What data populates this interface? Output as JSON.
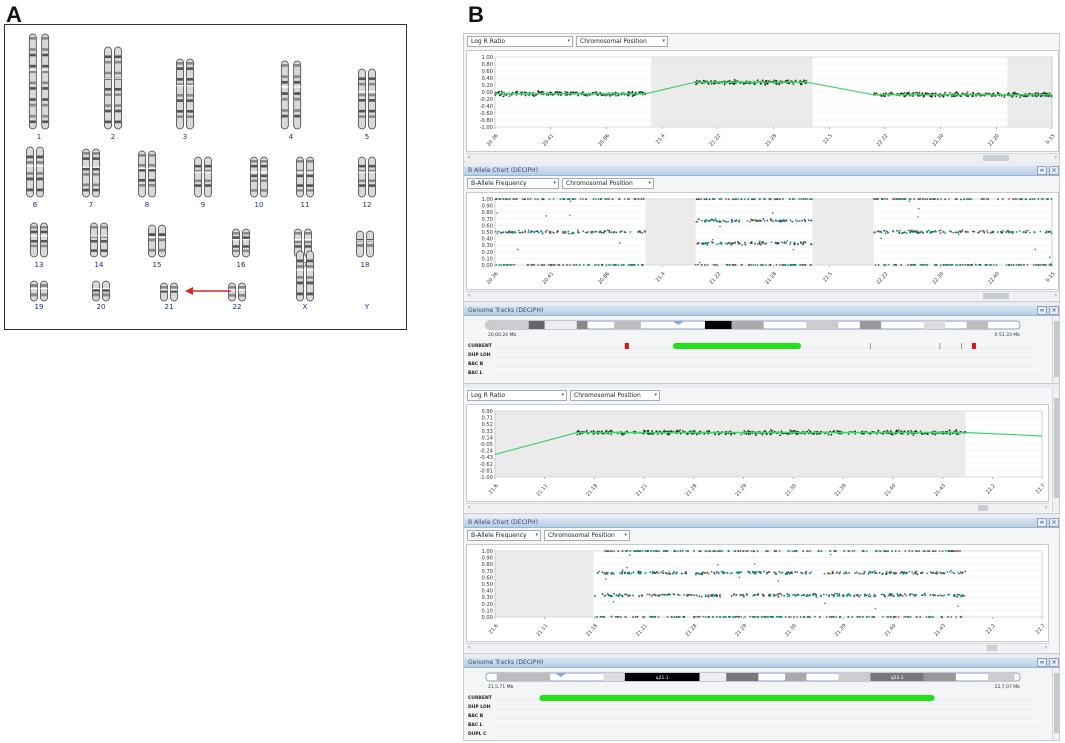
{
  "figure": {
    "panel_a_letter": "A",
    "panel_b_letter": "B"
  },
  "karyotype": {
    "rows": [
      [
        "1",
        "2",
        "3",
        "4",
        "5"
      ],
      [
        "6",
        "7",
        "8",
        "9",
        "10",
        "11",
        "12"
      ],
      [
        "13",
        "14",
        "15",
        "16",
        "17",
        "18"
      ],
      [
        "19",
        "20",
        "21",
        "22",
        "X",
        "Y"
      ]
    ],
    "arrow_target": "21"
  },
  "viewer": {
    "panes": {
      "lrr1": {
        "dropdown1": "Log R Ratio",
        "dropdown2": "Chromosomal Position",
        "yticks": [
          "1.00",
          "0.80",
          "0.60",
          "0.40",
          "0.20",
          "0.00",
          "-0.20",
          "-0.40",
          "-0.60",
          "-0.80",
          "-1.00"
        ],
        "xticks": [
          "20.36",
          "20.41",
          "20.86",
          "21.4",
          "21.22",
          "21.28",
          "22.5",
          "22.22",
          "22.30",
          "22.20",
          "b.15"
        ]
      },
      "baf1": {
        "title": "B Allele Chart (DECIPH)",
        "dropdown1": "B-Allele Frequency",
        "dropdown2": "Chromosomal Position",
        "yticks": [
          "1.00",
          "0.90",
          "0.80",
          "0.70",
          "0.60",
          "0.50",
          "0.40",
          "0.30",
          "0.20",
          "0.10",
          "0.00"
        ],
        "xticks": [
          "20.36",
          "20.41",
          "20.86",
          "21.4",
          "21.22",
          "21.28",
          "22.5",
          "22.22",
          "22.30",
          "22.40",
          "b.15"
        ]
      },
      "genome1": {
        "title": "Genome Tracks (DECIPH)",
        "left_coord": "20,00,24 Mb",
        "right_coord": "X 51,33 Mb",
        "rows": [
          "CURRENT",
          "DUP LOH",
          "BAC B",
          "BAC L"
        ]
      },
      "lrr2": {
        "dropdown1": "Log R Ratio",
        "dropdown2": "Chromosomal Position",
        "yticks": [
          "0.90",
          "0.71",
          "0.52",
          "0.33",
          "0.14",
          "-0.05",
          "-0.24",
          "-0.43",
          "-0.62",
          "-0.81",
          "-1.00"
        ],
        "xticks": [
          "21.6",
          "21.11",
          "21.18",
          "21.21",
          "21.28",
          "21.29",
          "21.30",
          "21.39",
          "21.40",
          "21.43",
          "22.2",
          "22.7"
        ]
      },
      "baf2": {
        "title": "B Allele Chart (DECIPH)",
        "dropdown1": "B-Allele Frequency",
        "dropdown2": "Chromosomal Position",
        "yticks": [
          "1.00",
          "0.90",
          "0.80",
          "0.70",
          "0.60",
          "0.50",
          "0.40",
          "0.30",
          "0.20",
          "0.10",
          "0.00"
        ],
        "xticks": [
          "21.6",
          "21.11",
          "21.18",
          "21.21",
          "21.28",
          "21.29",
          "21.30",
          "21.39",
          "21.40",
          "21.43",
          "22.2",
          "22.7"
        ]
      },
      "genome2": {
        "title": "Genome Tracks (DECIPH)",
        "left_coord": "21,5,71 Mb",
        "right_coord": "22,7,07 Mb",
        "band_left": "q21.1",
        "band_right": "q22.3",
        "rows": [
          "CURRENT",
          "DUP LOH",
          "BAC B",
          "BAC L",
          "DUPL C"
        ]
      }
    }
  },
  "chart_data": [
    {
      "type": "scatter",
      "ylabel": "Log R Ratio",
      "xlabel": "Chromosomal Position",
      "ylim": [
        -1.0,
        1.0
      ],
      "series": [
        {
          "segments": [
            {
              "x_range": [
                0.0,
                0.27
              ],
              "y": -0.05
            },
            {
              "x_range": [
                0.36,
                0.56
              ],
              "y": 0.28
            },
            {
              "x_range": [
                0.68,
                1.0
              ],
              "y": -0.08
            }
          ]
        }
      ]
    },
    {
      "type": "scatter",
      "ylabel": "B-Allele Frequency",
      "xlabel": "Chromosomal Position",
      "ylim": [
        0.0,
        1.0
      ],
      "bands": [
        {
          "x_range": [
            0.0,
            0.27
          ],
          "levels": [
            0.0,
            0.5,
            1.0
          ]
        },
        {
          "x_range": [
            0.36,
            0.57
          ],
          "levels": [
            0.0,
            0.33,
            0.67,
            1.0
          ]
        },
        {
          "x_range": [
            0.68,
            1.0
          ],
          "levels": [
            0.0,
            0.5,
            1.0
          ]
        }
      ]
    },
    {
      "type": "scatter",
      "ylabel": "Log R Ratio",
      "xlabel": "Chromosomal Position",
      "ylim": [
        -1.0,
        0.9
      ],
      "series": [
        {
          "segments": [
            {
              "x_range": [
                0.15,
                0.86
              ],
              "y": 0.28
            }
          ]
        }
      ]
    },
    {
      "type": "scatter",
      "ylabel": "B-Allele Frequency",
      "xlabel": "Chromosomal Position",
      "ylim": [
        0.0,
        1.0
      ],
      "bands": [
        {
          "x_range": [
            0.18,
            0.86
          ],
          "levels": [
            0.0,
            0.33,
            0.67,
            1.0
          ]
        }
      ]
    }
  ]
}
